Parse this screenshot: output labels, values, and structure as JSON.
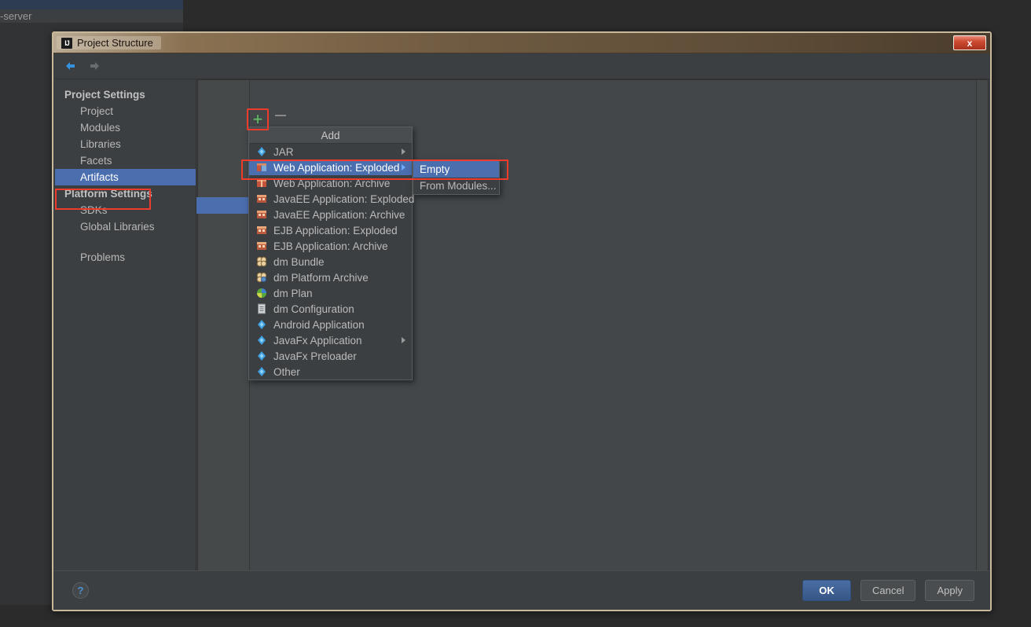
{
  "background": {
    "editor_tab_text": "-server"
  },
  "dialog": {
    "title": "Project Structure",
    "logo": "IJ",
    "close_label": "x",
    "close_icon": "close-icon"
  },
  "toolbar": {
    "back_icon": "back-arrow-icon",
    "forward_icon": "forward-arrow-icon",
    "add_icon": "plus-icon",
    "add_label": "+",
    "remove_icon": "minus-icon"
  },
  "sidebar": {
    "groups": [
      {
        "label": "Project Settings",
        "items": [
          {
            "label": "Project",
            "selected": false
          },
          {
            "label": "Modules",
            "selected": false
          },
          {
            "label": "Libraries",
            "selected": false
          },
          {
            "label": "Facets",
            "selected": false
          },
          {
            "label": "Artifacts",
            "selected": true
          }
        ]
      },
      {
        "label": "Platform Settings",
        "items": [
          {
            "label": "SDKs",
            "selected": false
          },
          {
            "label": "Global Libraries",
            "selected": false
          }
        ]
      }
    ],
    "extra": [
      {
        "label": "Problems",
        "selected": false
      }
    ]
  },
  "add_menu": {
    "header": "Add",
    "items": [
      {
        "label": "JAR",
        "icon": "jar-diamond-icon",
        "submenu": true,
        "selected": false
      },
      {
        "label": "Web Application: Exploded",
        "icon": "web-app-exploded-icon",
        "submenu": true,
        "selected": true
      },
      {
        "label": "Web Application: Archive",
        "icon": "web-app-archive-icon",
        "submenu": false,
        "selected": false
      },
      {
        "label": "JavaEE Application: Exploded",
        "icon": "javaee-exploded-icon",
        "submenu": false,
        "selected": false
      },
      {
        "label": "JavaEE Application: Archive",
        "icon": "javaee-archive-icon",
        "submenu": false,
        "selected": false
      },
      {
        "label": "EJB Application: Exploded",
        "icon": "ejb-exploded-icon",
        "submenu": false,
        "selected": false
      },
      {
        "label": "EJB Application: Archive",
        "icon": "ejb-archive-icon",
        "submenu": false,
        "selected": false
      },
      {
        "label": "dm Bundle",
        "icon": "dm-bundle-icon",
        "submenu": false,
        "selected": false
      },
      {
        "label": "dm Platform Archive",
        "icon": "dm-platform-archive-icon",
        "submenu": false,
        "selected": false
      },
      {
        "label": "dm Plan",
        "icon": "dm-plan-icon",
        "submenu": false,
        "selected": false
      },
      {
        "label": "dm Configuration",
        "icon": "dm-configuration-icon",
        "submenu": false,
        "selected": false
      },
      {
        "label": "Android Application",
        "icon": "android-app-icon",
        "submenu": false,
        "selected": false
      },
      {
        "label": "JavaFx Application",
        "icon": "javafx-app-icon",
        "submenu": true,
        "selected": false
      },
      {
        "label": "JavaFx Preloader",
        "icon": "javafx-preloader-icon",
        "submenu": false,
        "selected": false
      },
      {
        "label": "Other",
        "icon": "other-icon",
        "submenu": false,
        "selected": false
      }
    ]
  },
  "sub_menu": {
    "items": [
      {
        "label": "Empty",
        "selected": true
      },
      {
        "label": "From Modules...",
        "selected": false
      }
    ]
  },
  "footer": {
    "help_label": "?",
    "help_icon": "help-icon",
    "buttons": [
      {
        "label": "OK",
        "primary": true
      },
      {
        "label": "Cancel",
        "primary": false
      },
      {
        "label": "Apply",
        "primary": false
      }
    ]
  },
  "colors": {
    "accent_selection": "#4b6eaf",
    "highlight_box": "#ef3b2b",
    "panel_bg": "#3c3f41",
    "title_bar": "#6e5a41",
    "add_icon_green": "#62c462",
    "close_red": "#cd4b32"
  }
}
